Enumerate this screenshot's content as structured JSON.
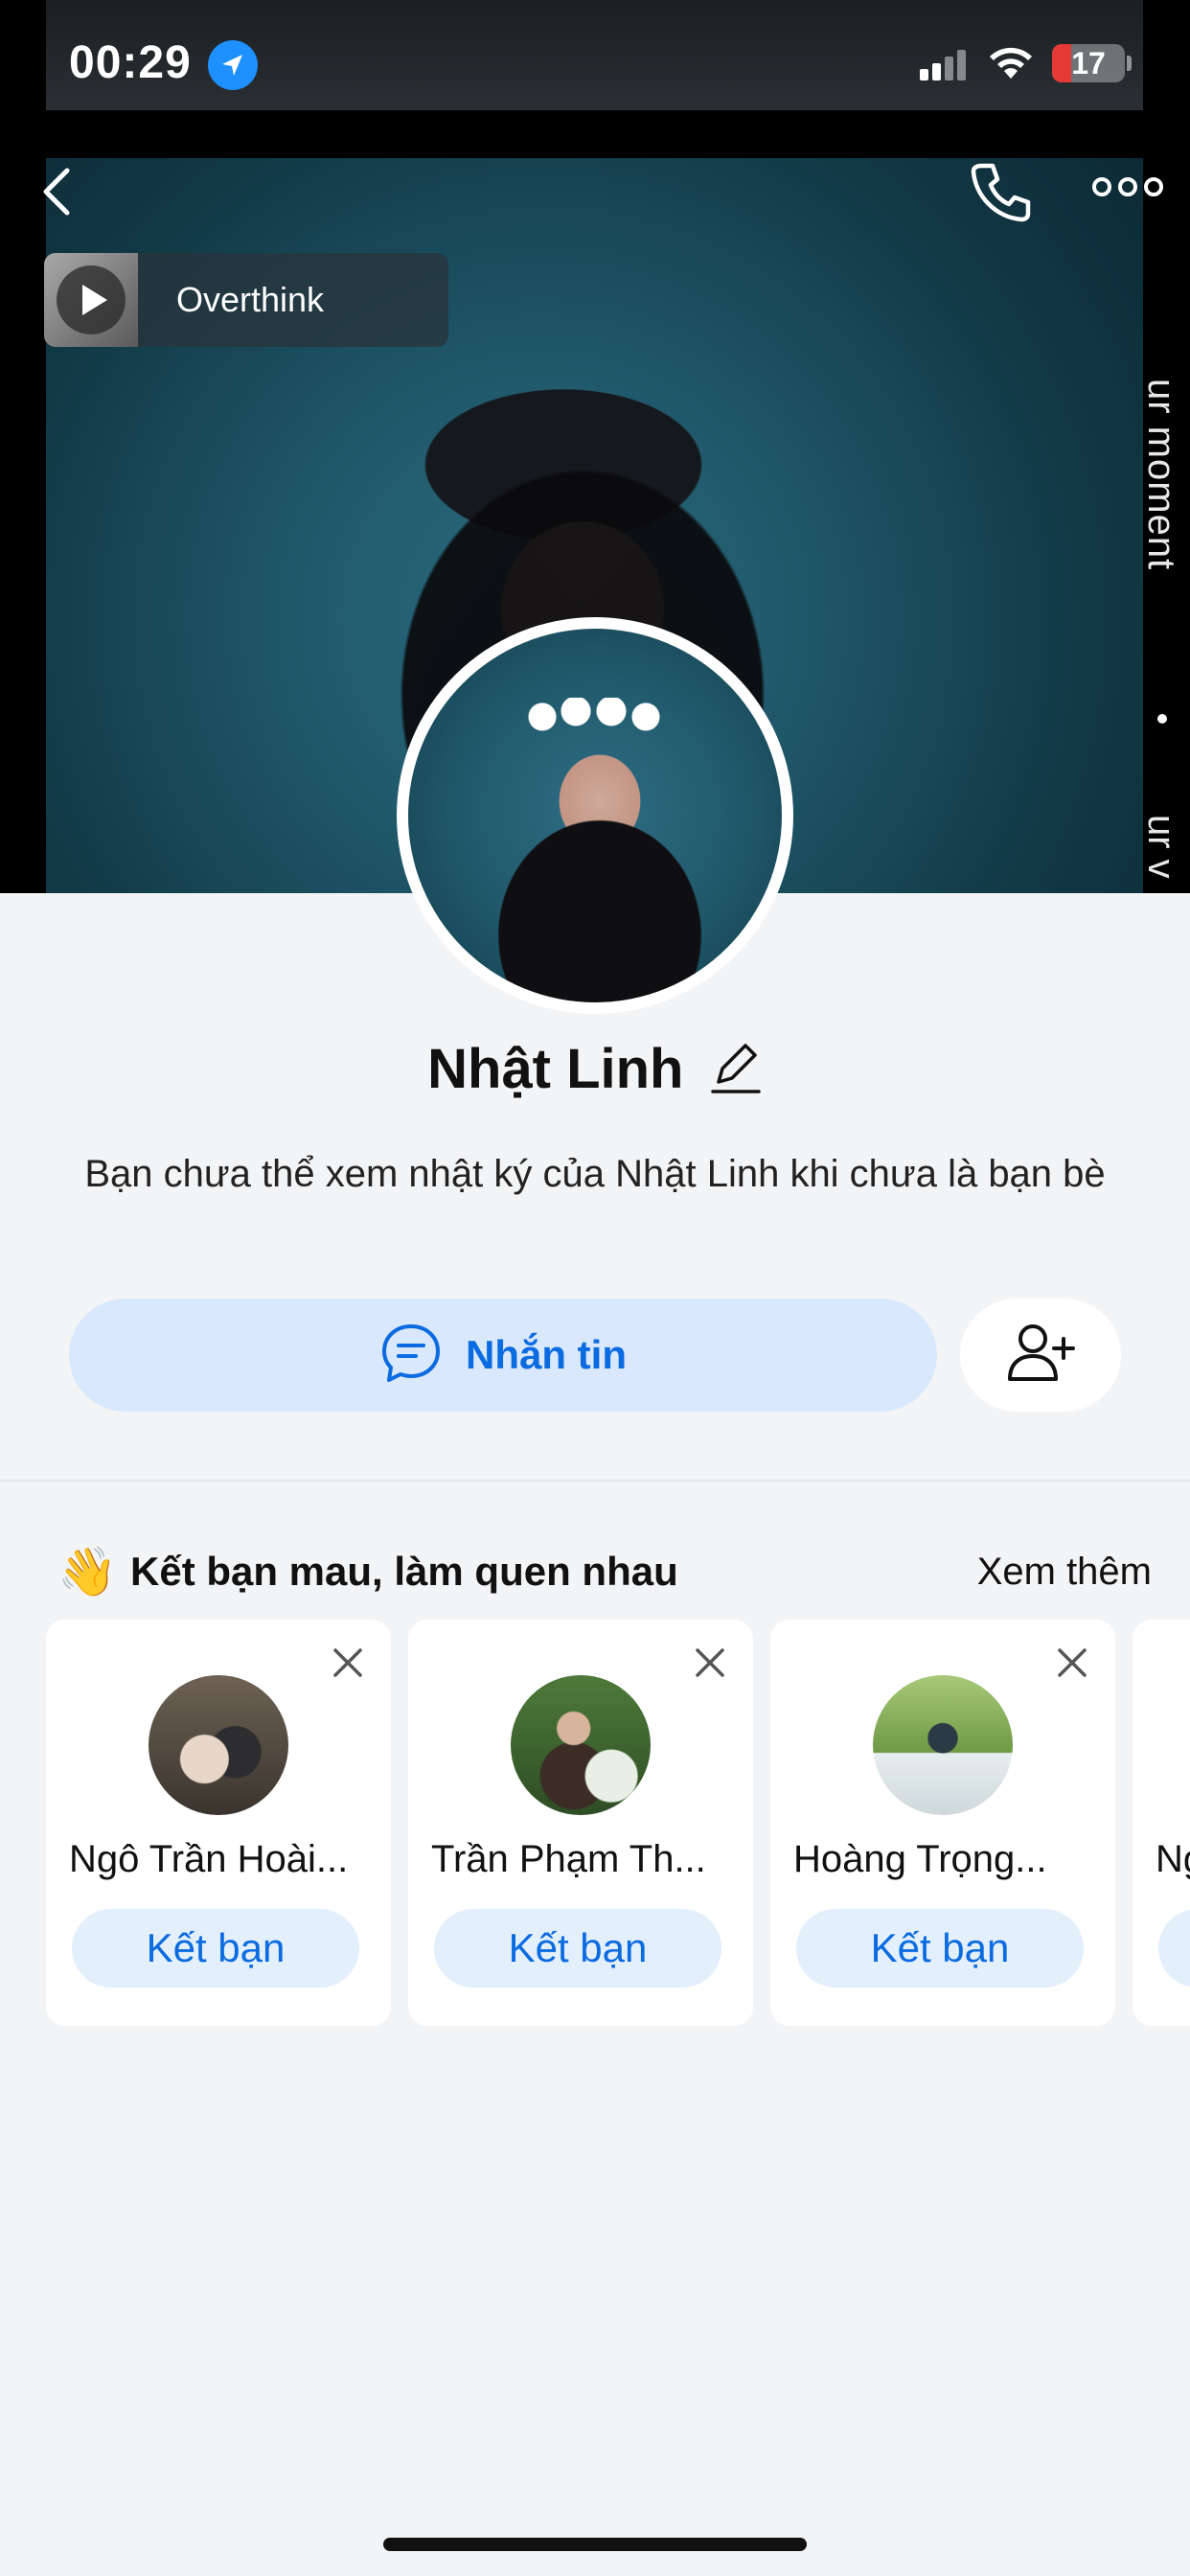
{
  "status_bar": {
    "time": "00:29",
    "battery": "17"
  },
  "cover": {
    "side_text_top": "ur moment",
    "side_text_bottom": "ur v"
  },
  "music": {
    "title": "Overthink"
  },
  "profile": {
    "name": "Nhật Linh",
    "notice": "Bạn chưa thể xem nhật ký của Nhật Linh khi chưa là bạn bè"
  },
  "actions": {
    "message_label": "Nhắn tin"
  },
  "suggestions": {
    "title": "Kết bạn mau, làm quen nhau",
    "emoji": "👋",
    "see_more": "Xem thêm",
    "people": [
      {
        "name": "Ngô Trần Hoài...",
        "button": "Kết bạn"
      },
      {
        "name": "Trần Phạm Th...",
        "button": "Kết bạn"
      },
      {
        "name": "Hoàng Trọng...",
        "button": "Kết bạn"
      },
      {
        "name": "Ng",
        "button": ""
      }
    ]
  }
}
